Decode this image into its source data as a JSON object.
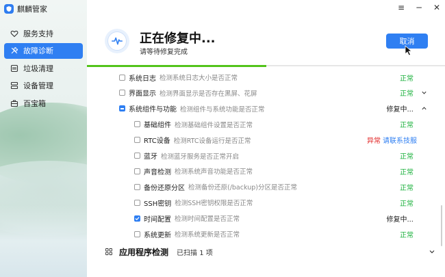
{
  "app": {
    "name": "麒麟管家"
  },
  "window_controls": {
    "menu": "≡",
    "minimize": "−",
    "close": "✕"
  },
  "sidebar": {
    "items": [
      {
        "label": "服务支持",
        "icon": "heart-icon",
        "active": false
      },
      {
        "label": "故障诊断",
        "icon": "tools-icon",
        "active": true
      },
      {
        "label": "垃圾清理",
        "icon": "broom-icon",
        "active": false
      },
      {
        "label": "设备管理",
        "icon": "device-icon",
        "active": false
      },
      {
        "label": "百宝箱",
        "icon": "toolbox-icon",
        "active": false
      }
    ]
  },
  "header": {
    "title": "正在修复中...",
    "subtitle": "请等待修复完成",
    "cancel_label": "取消",
    "progress": 0.5
  },
  "checks": [
    {
      "name": "系统日志",
      "desc": "检测系统日志大小是否正常",
      "status": "正常",
      "status_kind": "ok",
      "checkbox": "unchecked",
      "level": 1
    },
    {
      "name": "界面显示",
      "desc": "检测界面显示是否存在黑屏、花屏",
      "status": "正常",
      "status_kind": "ok",
      "checkbox": "unchecked",
      "level": 1,
      "chevron": "down"
    },
    {
      "name": "系统组件与功能",
      "desc": "检测组件与系统功能是否正常",
      "status": "修复中...",
      "status_kind": "busy",
      "checkbox": "partial",
      "level": 1,
      "chevron": "up"
    },
    {
      "name": "基础组件",
      "desc": "检测基础组件设置是否正常",
      "status": "正常",
      "status_kind": "ok",
      "checkbox": "unchecked",
      "level": 2
    },
    {
      "name": "RTC设备",
      "desc": "检测RTC设备运行是否正常",
      "status": "异常",
      "status_kind": "error",
      "action": "请联系技服",
      "checkbox": "unchecked",
      "level": 2
    },
    {
      "name": "蓝牙",
      "desc": "检测蓝牙服务是否正常开启",
      "status": "正常",
      "status_kind": "ok",
      "checkbox": "unchecked",
      "level": 2
    },
    {
      "name": "声音检测",
      "desc": "检测系统声音功能是否正常",
      "status": "正常",
      "status_kind": "ok",
      "checkbox": "unchecked",
      "level": 2
    },
    {
      "name": "备份还原分区",
      "desc": "检测备份还原(/backup)分区是否正常",
      "status": "正常",
      "status_kind": "ok",
      "checkbox": "unchecked",
      "level": 2
    },
    {
      "name": "SSH密钥",
      "desc": "检测SSH密钥权限是否正常",
      "status": "正常",
      "status_kind": "ok",
      "checkbox": "unchecked",
      "level": 2
    },
    {
      "name": "时间配置",
      "desc": "检测时间配置是否正常",
      "status": "修复中...",
      "status_kind": "busy",
      "checkbox": "checked",
      "level": 2
    },
    {
      "name": "系统更新",
      "desc": "检测系统更新是否正常",
      "status": "正常",
      "status_kind": "ok",
      "checkbox": "unchecked",
      "level": 2
    }
  ],
  "section": {
    "title": "应用程序检测",
    "meta": "已扫描 1 项"
  },
  "colors": {
    "accent": "#2f7ff2",
    "ok": "#1ab03b",
    "error": "#e02020",
    "progress": "#52c41a"
  }
}
